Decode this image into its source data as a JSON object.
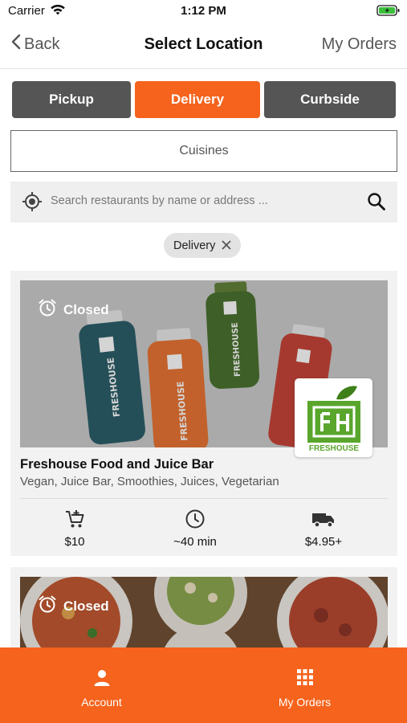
{
  "status_bar": {
    "carrier": "Carrier",
    "time": "1:12 PM"
  },
  "nav": {
    "back_label": "Back",
    "title": "Select Location",
    "right_label": "My Orders"
  },
  "order_types": [
    {
      "label": "Pickup",
      "selected": false
    },
    {
      "label": "Delivery",
      "selected": true
    },
    {
      "label": "Curbside",
      "selected": false
    }
  ],
  "cuisines": {
    "label": "Cuisines"
  },
  "search": {
    "placeholder": "Search restaurants by name or address ..."
  },
  "filter_chip": {
    "label": "Delivery"
  },
  "restaurants": [
    {
      "status": "Closed",
      "name": "Freshouse Food and Juice Bar",
      "tags": "Vegan, Juice Bar, Smoothies, Juices, Vegetarian",
      "logo_text": "FRESHOUSE",
      "bottle_label": "FRESHOUSE",
      "min_order": "$10",
      "delivery_time": "~40 min",
      "delivery_fee": "$4.95+"
    },
    {
      "status": "Closed"
    }
  ],
  "tab_bar": {
    "items": [
      {
        "label": "Account",
        "icon": "person-icon"
      },
      {
        "label": "My Orders",
        "icon": "grid-icon"
      }
    ]
  },
  "colors": {
    "accent": "#f5631c",
    "segment_inactive": "#555555",
    "logo_green": "#5aa62c"
  }
}
